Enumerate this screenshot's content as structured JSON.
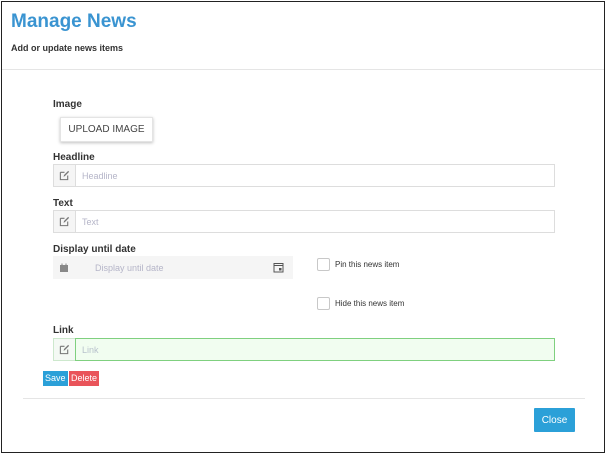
{
  "header": {
    "title": "Manage News",
    "subtitle": "Add or update news items"
  },
  "form": {
    "image_label": "Image",
    "upload_label": "UPLOAD IMAGE",
    "headline_label": "Headline",
    "headline_placeholder": "Headline",
    "headline_value": "",
    "text_label": "Text",
    "text_placeholder": "Text",
    "text_value": "",
    "date_label": "Display until date",
    "date_placeholder": "Display until date",
    "date_value": "",
    "pin_label": "Pin this news item",
    "pin_checked": false,
    "hide_label": "Hide this news item",
    "hide_checked": false,
    "link_label": "Link",
    "link_placeholder": "Link",
    "link_value": ""
  },
  "actions": {
    "save_label": "Save",
    "delete_label": "Delete",
    "close_label": "Close"
  },
  "icons": {
    "headline": "edit-icon",
    "text": "edit-icon",
    "date": "calendar-icon",
    "date_picker": "calendar-picker-icon",
    "link": "edit-icon"
  },
  "colors": {
    "title": "#3a94d1",
    "primary_button": "#2ba0d8",
    "danger_button": "#e9545a",
    "link_valid_border": "#7fd07f",
    "link_valid_bg": "#f1fdf0"
  }
}
